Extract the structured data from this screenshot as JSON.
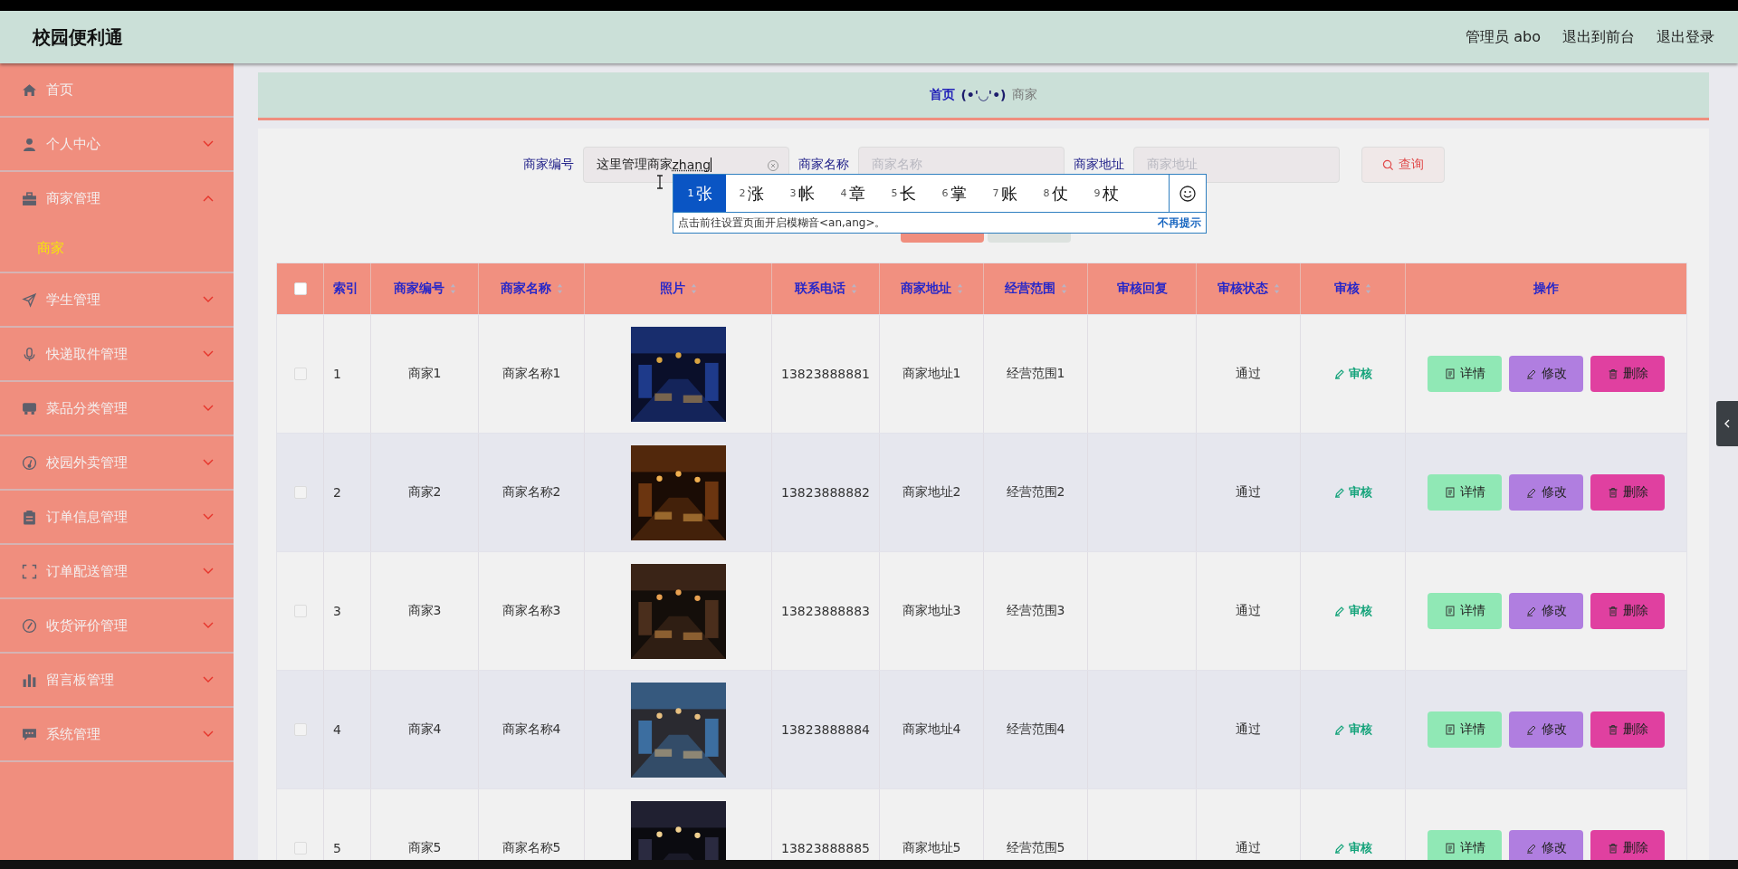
{
  "header": {
    "title": "校园便利通",
    "user": "管理员 abo",
    "links": [
      "退出到前台",
      "退出登录"
    ]
  },
  "sidebar": {
    "items": [
      {
        "label": "首页"
      },
      {
        "label": "个人中心",
        "expanded": false
      },
      {
        "label": "商家管理",
        "expanded": true,
        "children": [
          {
            "label": "商家",
            "selected": true
          }
        ]
      },
      {
        "label": "学生管理",
        "expanded": false
      },
      {
        "label": "快递取件管理",
        "expanded": false
      },
      {
        "label": "菜品分类管理",
        "expanded": false
      },
      {
        "label": "校园外卖管理",
        "expanded": false
      },
      {
        "label": "订单信息管理",
        "expanded": false
      },
      {
        "label": "订单配送管理",
        "expanded": false
      },
      {
        "label": "收货评价管理",
        "expanded": false
      },
      {
        "label": "留言板管理",
        "expanded": false
      },
      {
        "label": "系统管理",
        "expanded": false
      }
    ]
  },
  "breadcrumb": {
    "home": "首页",
    "face": "(•'◡'•)",
    "current": "商家"
  },
  "search": {
    "fields": [
      {
        "label": "商家编号",
        "value": "这里管理商家",
        "composing": "zhang"
      },
      {
        "label": "商家名称",
        "placeholder": "商家名称"
      },
      {
        "label": "商家地址",
        "placeholder": "商家地址"
      }
    ],
    "button": "查询"
  },
  "ime": {
    "candidates": [
      {
        "index": "1",
        "text": "张",
        "selected": true
      },
      {
        "index": "2",
        "text": "涨",
        "selected": false
      },
      {
        "index": "3",
        "text": "帐",
        "selected": false
      },
      {
        "index": "4",
        "text": "章",
        "selected": false
      },
      {
        "index": "5",
        "text": "长",
        "selected": false
      },
      {
        "index": "6",
        "text": "掌",
        "selected": false
      },
      {
        "index": "7",
        "text": "账",
        "selected": false
      },
      {
        "index": "8",
        "text": "仗",
        "selected": false
      },
      {
        "index": "9",
        "text": "杖",
        "selected": false
      }
    ],
    "hint": "点击前往设置页面开启模糊音<an,ang>。",
    "dismiss": "不再提示"
  },
  "table": {
    "select_all_checked": false,
    "columns": [
      {
        "label": "索引",
        "sortable": false
      },
      {
        "label": "商家编号",
        "sortable": true
      },
      {
        "label": "商家名称",
        "sortable": true
      },
      {
        "label": "照片",
        "sortable": true
      },
      {
        "label": "联系电话",
        "sortable": true
      },
      {
        "label": "商家地址",
        "sortable": true
      },
      {
        "label": "经营范围",
        "sortable": true
      },
      {
        "label": "审核回复",
        "sortable": false
      },
      {
        "label": "审核状态",
        "sortable": true
      },
      {
        "label": "审核",
        "sortable": true
      },
      {
        "label": "操作",
        "sortable": false
      }
    ],
    "rows": [
      {
        "index": "1",
        "code": "商家1",
        "name": "商家名称1",
        "phone": "13823888881",
        "address": "商家地址1",
        "scope": "经营范围1",
        "status": "通过",
        "review": "审核",
        "checked": false,
        "actions": [
          {
            "kind": "detail",
            "label": "详情"
          },
          {
            "kind": "edit",
            "label": "修改"
          },
          {
            "kind": "delete",
            "label": "删除"
          }
        ]
      },
      {
        "index": "2",
        "code": "商家2",
        "name": "商家名称2",
        "phone": "13823888882",
        "address": "商家地址2",
        "scope": "经营范围2",
        "status": "通过",
        "review": "审核",
        "checked": false,
        "actions": [
          {
            "kind": "detail",
            "label": "详情"
          },
          {
            "kind": "edit",
            "label": "修改"
          },
          {
            "kind": "delete",
            "label": "删除"
          }
        ]
      },
      {
        "index": "3",
        "code": "商家3",
        "name": "商家名称3",
        "phone": "13823888883",
        "address": "商家地址3",
        "scope": "经营范围3",
        "status": "通过",
        "review": "审核",
        "checked": false,
        "actions": [
          {
            "kind": "detail",
            "label": "详情"
          },
          {
            "kind": "edit",
            "label": "修改"
          },
          {
            "kind": "delete",
            "label": "删除"
          }
        ]
      },
      {
        "index": "4",
        "code": "商家4",
        "name": "商家名称4",
        "phone": "13823888884",
        "address": "商家地址4",
        "scope": "经营范围4",
        "status": "通过",
        "review": "审核",
        "checked": false,
        "actions": [
          {
            "kind": "detail",
            "label": "详情"
          },
          {
            "kind": "edit",
            "label": "修改"
          },
          {
            "kind": "delete",
            "label": "删除"
          }
        ]
      },
      {
        "index": "5",
        "code": "商家5",
        "name": "商家名称5",
        "phone": "13823888885",
        "address": "商家地址5",
        "scope": "经营范围5",
        "status": "通过",
        "review": "审核",
        "checked": false,
        "actions": [
          {
            "kind": "detail",
            "label": "详情"
          },
          {
            "kind": "edit",
            "label": "修改"
          },
          {
            "kind": "delete",
            "label": "删除"
          }
        ]
      }
    ]
  }
}
